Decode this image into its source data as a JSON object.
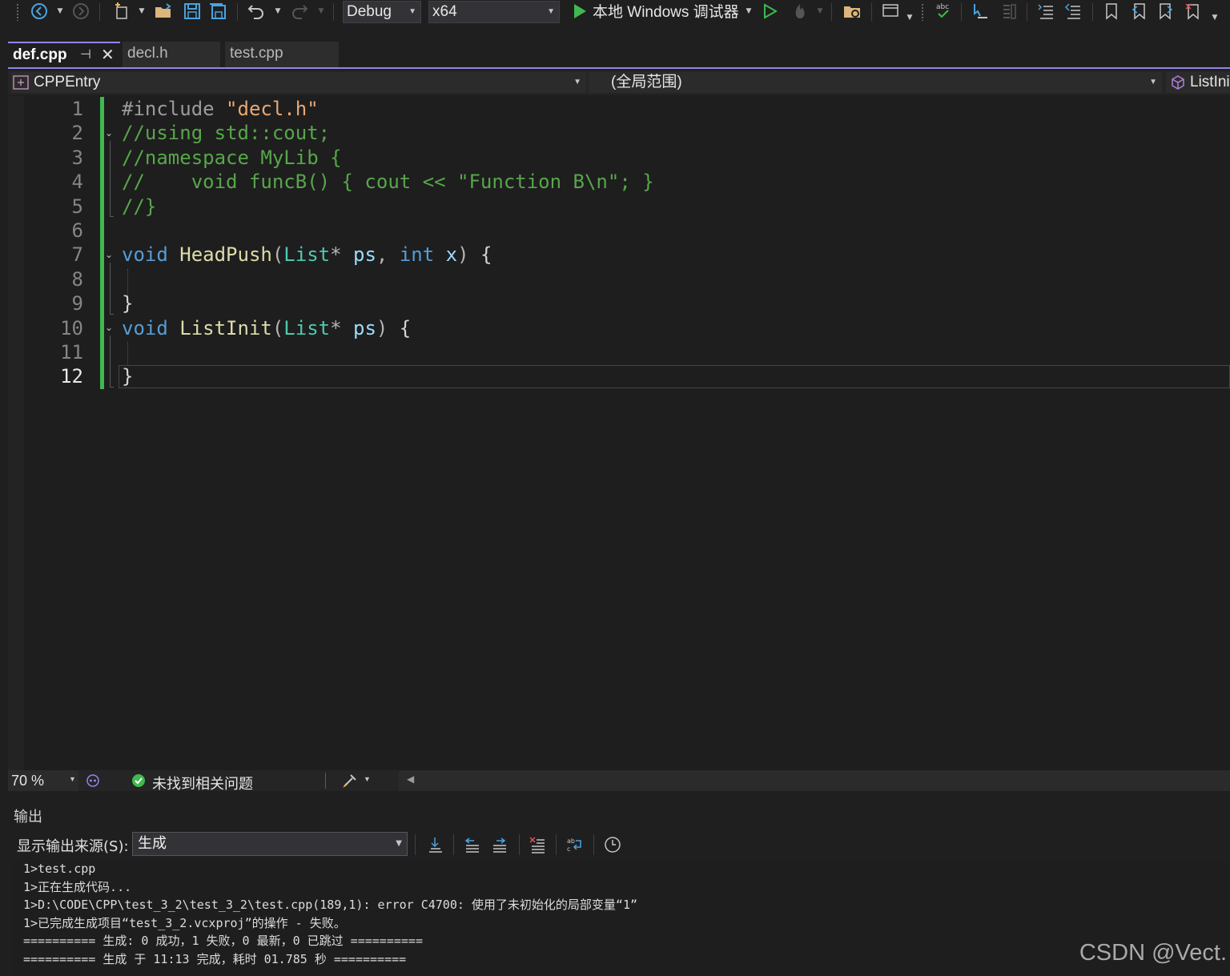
{
  "toolbar": {
    "config": "Debug",
    "platform": "x64",
    "run_label": "本地 Windows 调试器",
    "icons": [
      "back-icon",
      "forward-icon",
      "new-project-icon",
      "open-folder-icon",
      "save-icon",
      "save-all-icon",
      "undo-icon",
      "redo-icon",
      "play-icon",
      "play-outline-icon",
      "hot-reload-icon",
      "solution-explorer-icon",
      "window-layout-icon",
      "spell-check-icon",
      "cursor-icon",
      "format-icon",
      "indent-icon",
      "comment-icon",
      "bookmark-icon",
      "bookmark-prev-icon",
      "bookmark-next-icon",
      "bookmark-clear-icon"
    ]
  },
  "tabs": [
    {
      "label": "def.cpp",
      "active": true
    },
    {
      "label": "decl.h",
      "active": false
    },
    {
      "label": "test.cpp",
      "active": false
    }
  ],
  "navbar": {
    "project": "CPPEntry",
    "scope": "(全局范围)",
    "member": "ListIni"
  },
  "editor": {
    "current_line": 12,
    "line_numbers": [
      "1",
      "2",
      "3",
      "4",
      "5",
      "6",
      "7",
      "8",
      "9",
      "10",
      "11",
      "12"
    ],
    "lines": [
      [
        {
          "c": "pp",
          "t": "#include "
        },
        {
          "c": "s",
          "t": "\"decl.h\""
        }
      ],
      [
        {
          "c": "c",
          "t": "//using std::cout;"
        }
      ],
      [
        {
          "c": "c",
          "t": "//namespace MyLib {"
        }
      ],
      [
        {
          "c": "c",
          "t": "//    void funcB() { cout << \"Function B\\n\"; }"
        }
      ],
      [
        {
          "c": "c",
          "t": "//}"
        }
      ],
      [],
      [
        {
          "c": "k",
          "t": "void"
        },
        {
          "c": "",
          "t": " "
        },
        {
          "c": "f",
          "t": "HeadPush"
        },
        {
          "c": "o",
          "t": "("
        },
        {
          "c": "t",
          "t": "List"
        },
        {
          "c": "o",
          "t": "*"
        },
        {
          "c": "",
          "t": " "
        },
        {
          "c": "p",
          "t": "ps"
        },
        {
          "c": "o",
          "t": ","
        },
        {
          "c": "",
          "t": " "
        },
        {
          "c": "k",
          "t": "int"
        },
        {
          "c": "",
          "t": " "
        },
        {
          "c": "p",
          "t": "x"
        },
        {
          "c": "o",
          "t": ")"
        },
        {
          "c": "",
          "t": " {"
        }
      ],
      [],
      [
        {
          "c": "",
          "t": "}"
        }
      ],
      [
        {
          "c": "k",
          "t": "void"
        },
        {
          "c": "",
          "t": " "
        },
        {
          "c": "f",
          "t": "ListInit"
        },
        {
          "c": "o",
          "t": "("
        },
        {
          "c": "t",
          "t": "List"
        },
        {
          "c": "o",
          "t": "*"
        },
        {
          "c": "",
          "t": " "
        },
        {
          "c": "p",
          "t": "ps"
        },
        {
          "c": "o",
          "t": ")"
        },
        {
          "c": "",
          "t": " {"
        }
      ],
      [],
      [
        {
          "c": "",
          "t": "}"
        }
      ]
    ]
  },
  "status": {
    "zoom": "70 %",
    "issues": "未找到相关问题"
  },
  "output": {
    "title": "输出",
    "source_label": "显示输出来源(S):",
    "source_value": "生成",
    "lines": [
      "1>test.cpp",
      "1>正在生成代码...",
      "1>D:\\CODE\\CPP\\test_3_2\\test_3_2\\test.cpp(189,1): error C4700: 使用了未初始化的局部变量“1”",
      "1>已完成生成项目“test_3_2.vcxproj”的操作 - 失败。",
      "========== 生成: 0 成功，1 失败，0 最新，0 已跳过 ==========",
      "========== 生成 于 11:13 完成，耗时 01.785 秒 =========="
    ]
  },
  "watermark": "CSDN @Vect."
}
